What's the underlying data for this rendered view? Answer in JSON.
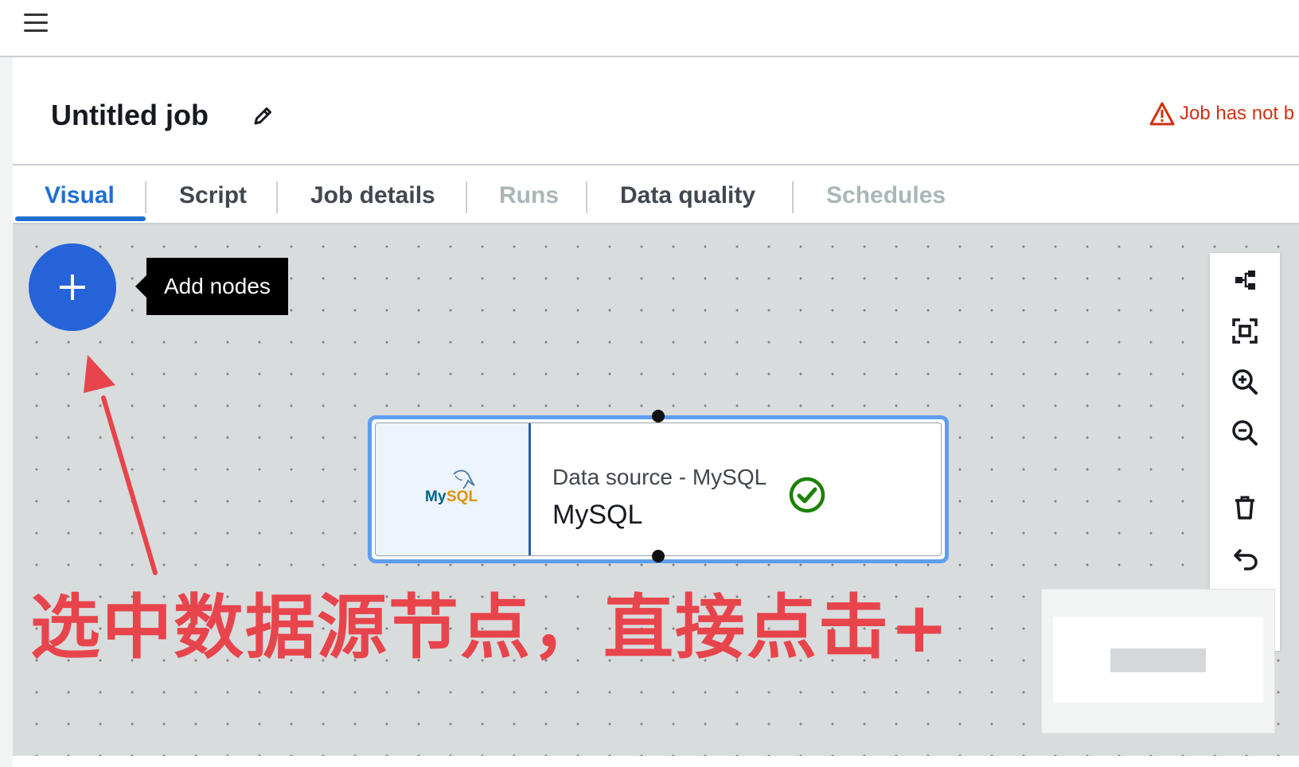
{
  "job": {
    "title": "Untitled job",
    "warning": "Job has not b"
  },
  "tabs": [
    {
      "label": "Visual",
      "state": "active"
    },
    {
      "label": "Script",
      "state": "normal"
    },
    {
      "label": "Job details",
      "state": "normal"
    },
    {
      "label": "Runs",
      "state": "disabled"
    },
    {
      "label": "Data quality",
      "state": "normal"
    },
    {
      "label": "Schedules",
      "state": "disabled"
    }
  ],
  "canvas": {
    "add_nodes_tooltip": "Add nodes",
    "node": {
      "logo_text": "MySQL",
      "type": "Data source - MySQL",
      "name": "MySQL",
      "status": "valid"
    },
    "annotation": "选中数据源节点，直接点击+"
  },
  "toolbar": {
    "buttons": [
      "layout-icon",
      "fit-view-icon",
      "zoom-in-icon",
      "zoom-out-icon",
      "delete-icon",
      "undo-icon",
      "redo-icon"
    ]
  },
  "colors": {
    "accent": "#1f6fd1",
    "add_button": "#2563d9",
    "warning": "#d13212",
    "annotation": "#e8444c",
    "success": "#1d8102"
  }
}
